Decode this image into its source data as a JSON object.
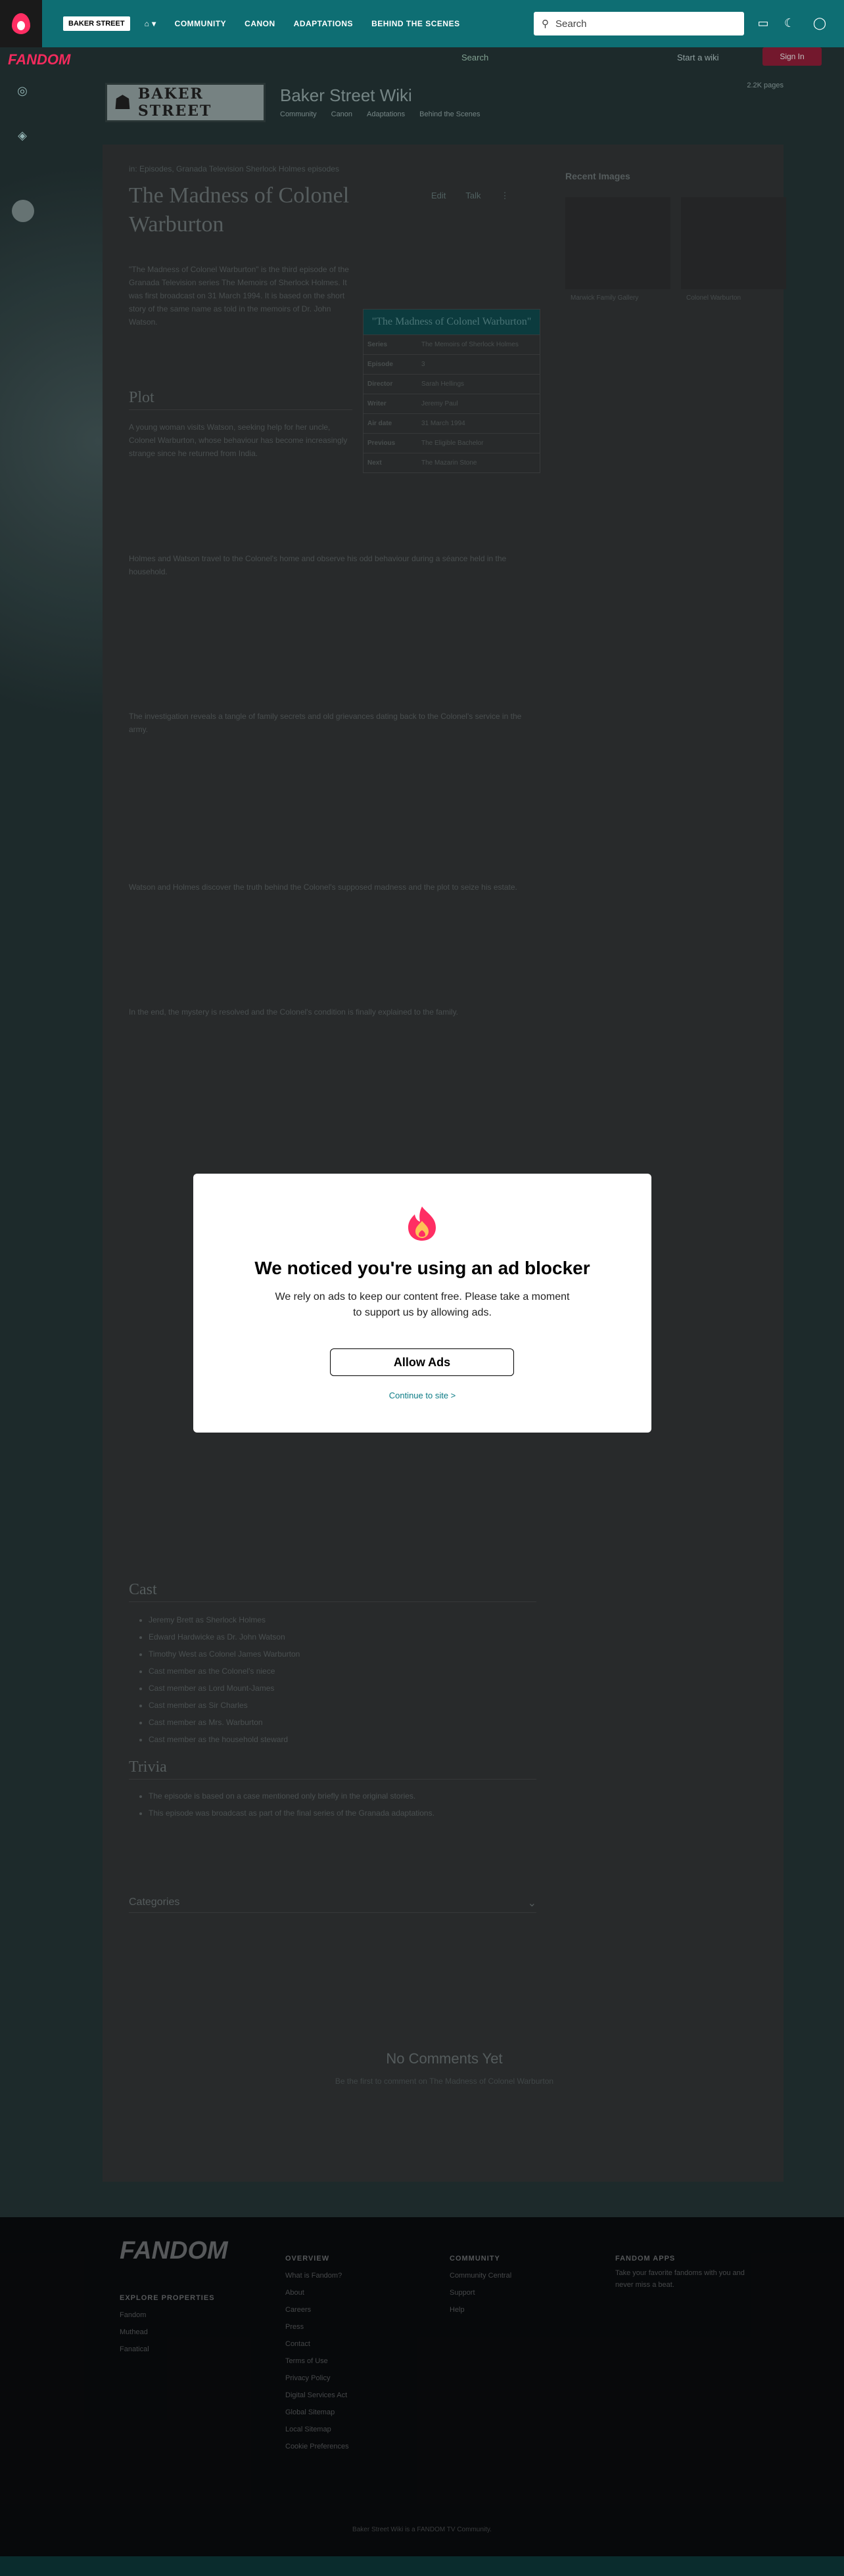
{
  "topnav": {
    "wiki_chip": "BAKER STREET",
    "links": [
      "COMMUNITY",
      "CANON",
      "ADAPTATIONS",
      "BEHIND THE SCENES"
    ],
    "search_placeholder": "Search"
  },
  "community": {
    "brand": "FANDOM",
    "search_label": "Search",
    "start_wiki": "Start a wiki",
    "sign_in": "Sign In"
  },
  "wiki": {
    "logo_text": "BAKER STREET",
    "name": "Baker Street Wiki",
    "nav": [
      "Community",
      "Canon",
      "Adaptations",
      "Behind the Scenes"
    ],
    "stats": "2.2K pages"
  },
  "article": {
    "breadcrumb": "in: Episodes, Granada Television Sherlock Holmes episodes",
    "title": "The Madness of Colonel Warburton",
    "action_edit": "Edit",
    "action_talk": "Talk",
    "intro": "\"The Madness of Colonel Warburton\" is the third episode of the Granada Television series The Memoirs of Sherlock Holmes. It was first broadcast on 31 March 1994. It is based on the short story of the same name as told in the memoirs of Dr. John Watson.",
    "plot_heading": "Plot",
    "plot_1": "A young woman visits Watson, seeking help for her uncle, Colonel Warburton, whose behaviour has become increasingly strange since he returned from India.",
    "plot_2": "Holmes and Watson travel to the Colonel's home and observe his odd behaviour during a séance held in the household.",
    "plot_3": "The investigation reveals a tangle of family secrets and old grievances dating back to the Colonel's service in the army.",
    "plot_4": "Watson and Holmes discover the truth behind the Colonel's supposed madness and the plot to seize his estate.",
    "plot_5": "In the end, the mystery is resolved and the Colonel's condition is finally explained to the family.",
    "cast_heading": "Cast",
    "cast": [
      "Jeremy Brett as Sherlock Holmes",
      "Edward Hardwicke as Dr. John Watson",
      "Timothy West as Colonel James Warburton",
      "Cast member as the Colonel's niece",
      "Cast member as Lord Mount-James",
      "Cast member as Sir Charles",
      "Cast member as Mrs. Warburton",
      "Cast member as the household steward"
    ],
    "trivia_heading": "Trivia",
    "trivia": [
      "The episode is based on a case mentioned only briefly in the original stories.",
      "This episode was broadcast as part of the final series of the Granada adaptations."
    ],
    "categories_label": "Categories",
    "comments_heading": "No Comments Yet",
    "comments_sub": "Be the first to comment on The Madness of Colonel Warburton"
  },
  "infobox": {
    "title": "\"The Madness of Colonel Warburton\"",
    "rows": [
      {
        "k": "Series",
        "v": "The Memoirs of Sherlock Holmes"
      },
      {
        "k": "Episode",
        "v": "3"
      },
      {
        "k": "Director",
        "v": "Sarah Hellings"
      },
      {
        "k": "Writer",
        "v": "Jeremy Paul"
      },
      {
        "k": "Air date",
        "v": "31 March 1994"
      },
      {
        "k": "Previous",
        "v": "The Eligible Bachelor"
      },
      {
        "k": "Next",
        "v": "The Mazarin Stone"
      }
    ]
  },
  "rail": {
    "title": "Recent Images",
    "caption_1": "Marwick Family Gallery",
    "caption_2": "Colonel Warburton"
  },
  "footer": {
    "brand": "FANDOM",
    "col1_head": "EXPLORE PROPERTIES",
    "col1": [
      "Fandom",
      "Muthead",
      "Fanatical"
    ],
    "col2_head": "OVERVIEW",
    "col2": [
      "What is Fandom?",
      "About",
      "Careers",
      "Press",
      "Contact",
      "Terms of Use",
      "Privacy Policy",
      "Digital Services Act",
      "Global Sitemap",
      "Local Sitemap",
      "Cookie Preferences"
    ],
    "col3_head": "COMMUNITY",
    "col3": [
      "Community Central",
      "Support",
      "Help"
    ],
    "col4_head": "FANDOM APPS",
    "col4_text": "Take your favorite fandoms with you and never miss a beat.",
    "legal": "Baker Street Wiki is a FANDOM TV Community."
  },
  "modal": {
    "heading": "We noticed you're using an ad blocker",
    "body": "We rely on ads to keep our content free. Please take a moment to support us by allowing ads.",
    "allow_label": "Allow Ads",
    "continue_label": "Continue to site >"
  }
}
